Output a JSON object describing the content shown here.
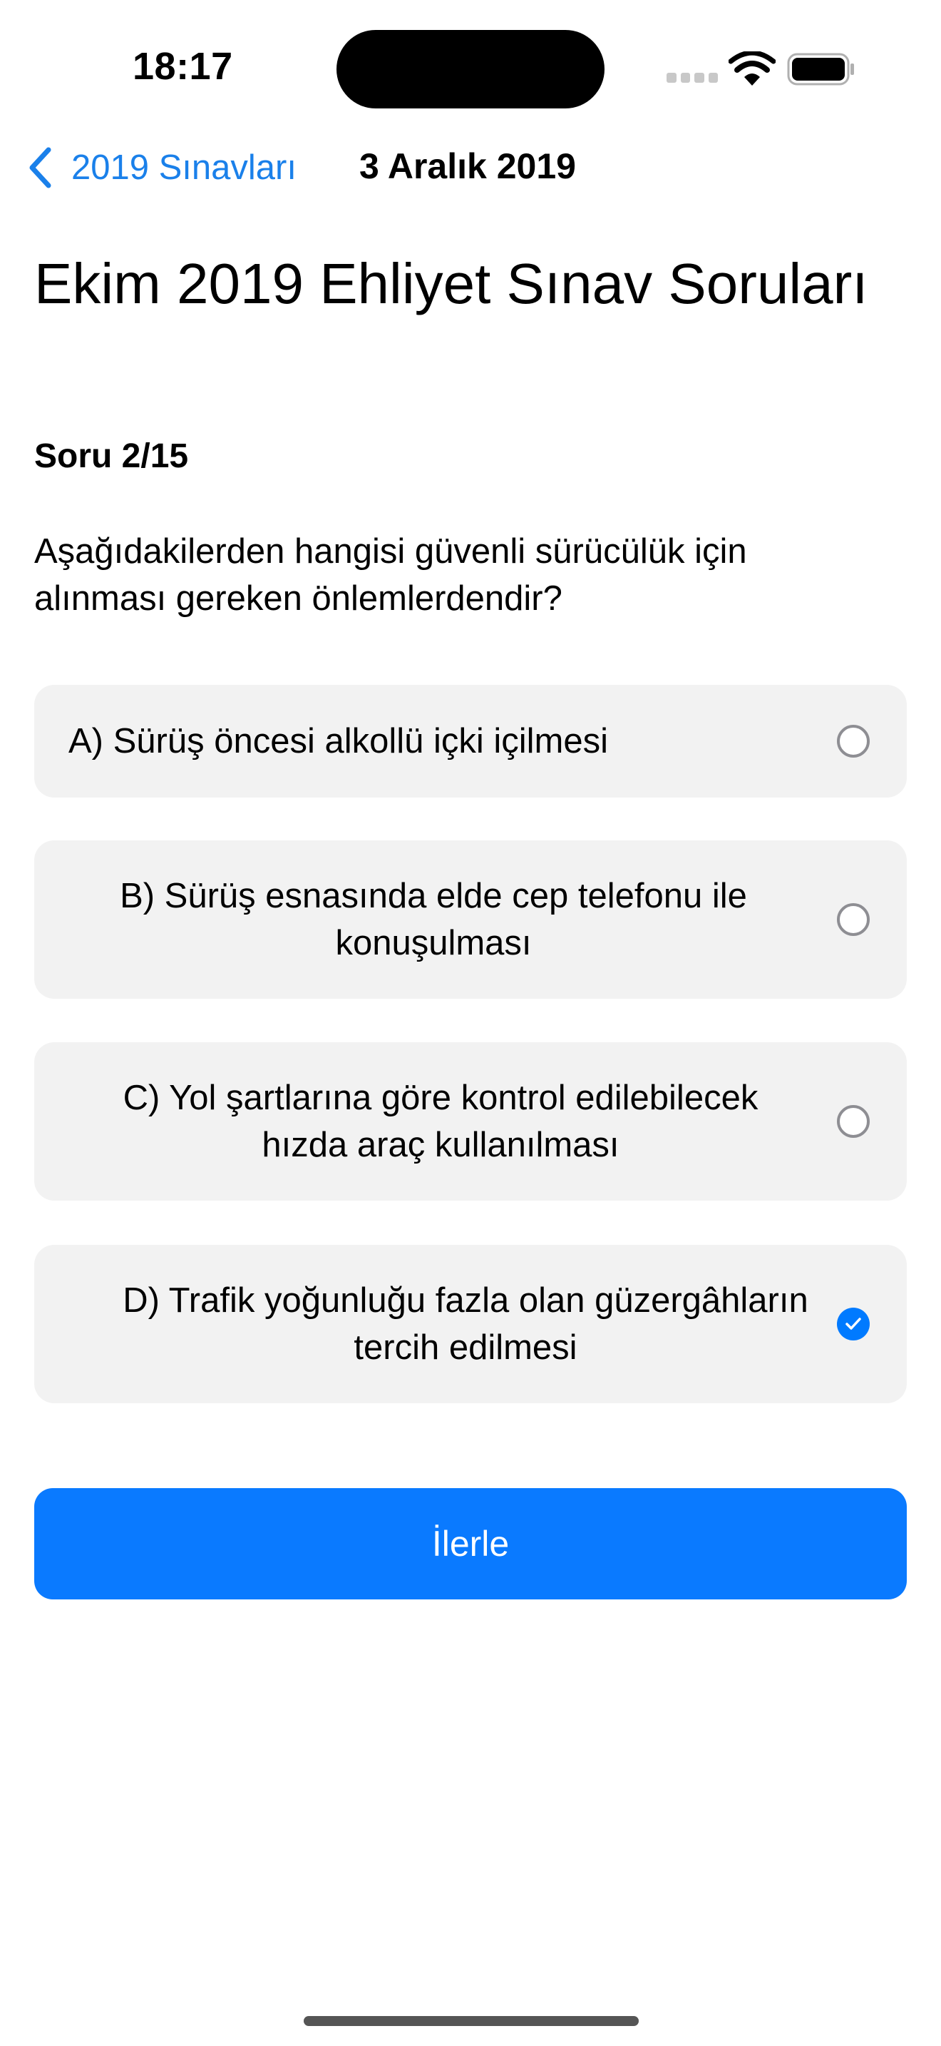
{
  "status_bar": {
    "time": "18:17"
  },
  "nav": {
    "back_label": "2019 Sınavları",
    "title": "3 Aralık 2019"
  },
  "page_title": "Ekim 2019 Ehliyet Sınav Soruları",
  "question": {
    "counter": "Soru 2/15",
    "text": "Aşağıdakilerden hangisi güvenli sürücülük için alınması gereken önlemlerdendir?",
    "options": [
      {
        "line1": "A) Sürüş öncesi alkollü içki içilmesi",
        "line2": "",
        "selected": false
      },
      {
        "line1": "B) Sürüş esnasında elde cep telefonu ile",
        "line2": "konuşulması",
        "selected": false
      },
      {
        "line1": "C) Yol şartlarına göre kontrol edilebilecek",
        "line2": "hızda araç kullanılması",
        "selected": false
      },
      {
        "line1": "D) Trafik yoğunluğu fazla olan güzergâhların",
        "line2": "tercih edilmesi",
        "selected": true
      }
    ]
  },
  "next_button": {
    "label": "İlerle"
  },
  "colors": {
    "accent": "#007aff",
    "option_background": "#f2f2f2"
  },
  "icons": [
    "chevron-left-icon",
    "signal-icon",
    "wifi-icon",
    "battery-icon",
    "radio-unchecked-icon",
    "radio-checked-icon"
  ]
}
